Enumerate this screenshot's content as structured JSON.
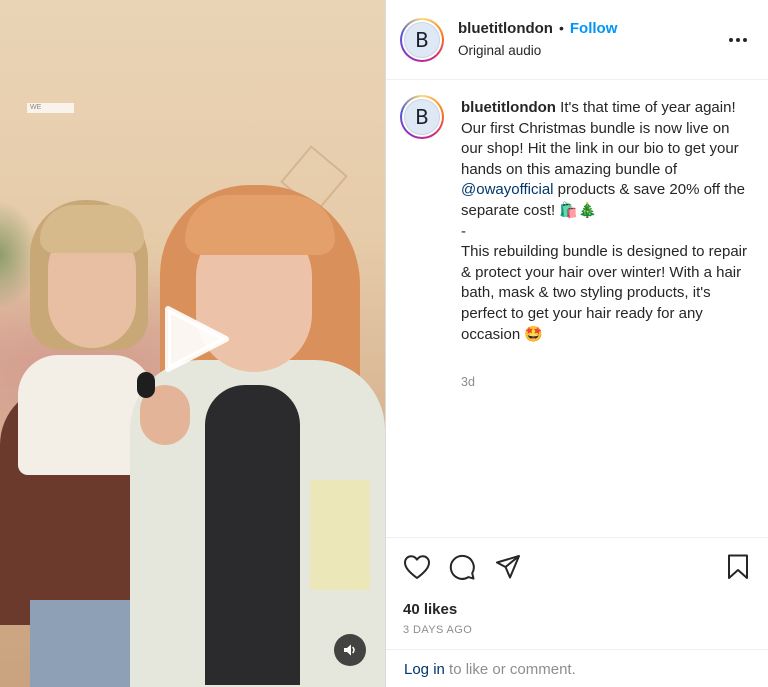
{
  "post": {
    "username": "bluetitlondon",
    "avatar_letter": "B",
    "separator": "•",
    "follow_label": "Follow",
    "audio_label": "Original audio",
    "caption_lines": [
      "It's that time of year again! Our first Christmas bundle is now live on our shop! Hit the link in our bio to get your hands on this amazing bundle of ",
      "@owayofficial",
      " products & save 20% off the separate cost! 🛍️🎄",
      "-",
      "This rebuilding bundle is designed to repair & protect your hair over winter! With a hair bath, mask & two styling products, it's perfect to get your hair ready for any occasion 🤩"
    ],
    "time_ago": "3d",
    "likes": "40 likes",
    "date": "3 DAYS AGO",
    "login_link": "Log in",
    "login_suffix": " to like or comment."
  },
  "media": {
    "watermark": "WE",
    "play_icon": "play-icon",
    "sound_icon": "speaker-icon"
  },
  "icons": {
    "more": "more-horizontal-icon",
    "like": "heart-icon",
    "comment": "comment-icon",
    "share": "send-icon",
    "save": "bookmark-icon"
  },
  "colors": {
    "follow": "#0095f6",
    "mention": "#00376b",
    "muted": "#8e8e8e",
    "text": "#262626"
  }
}
